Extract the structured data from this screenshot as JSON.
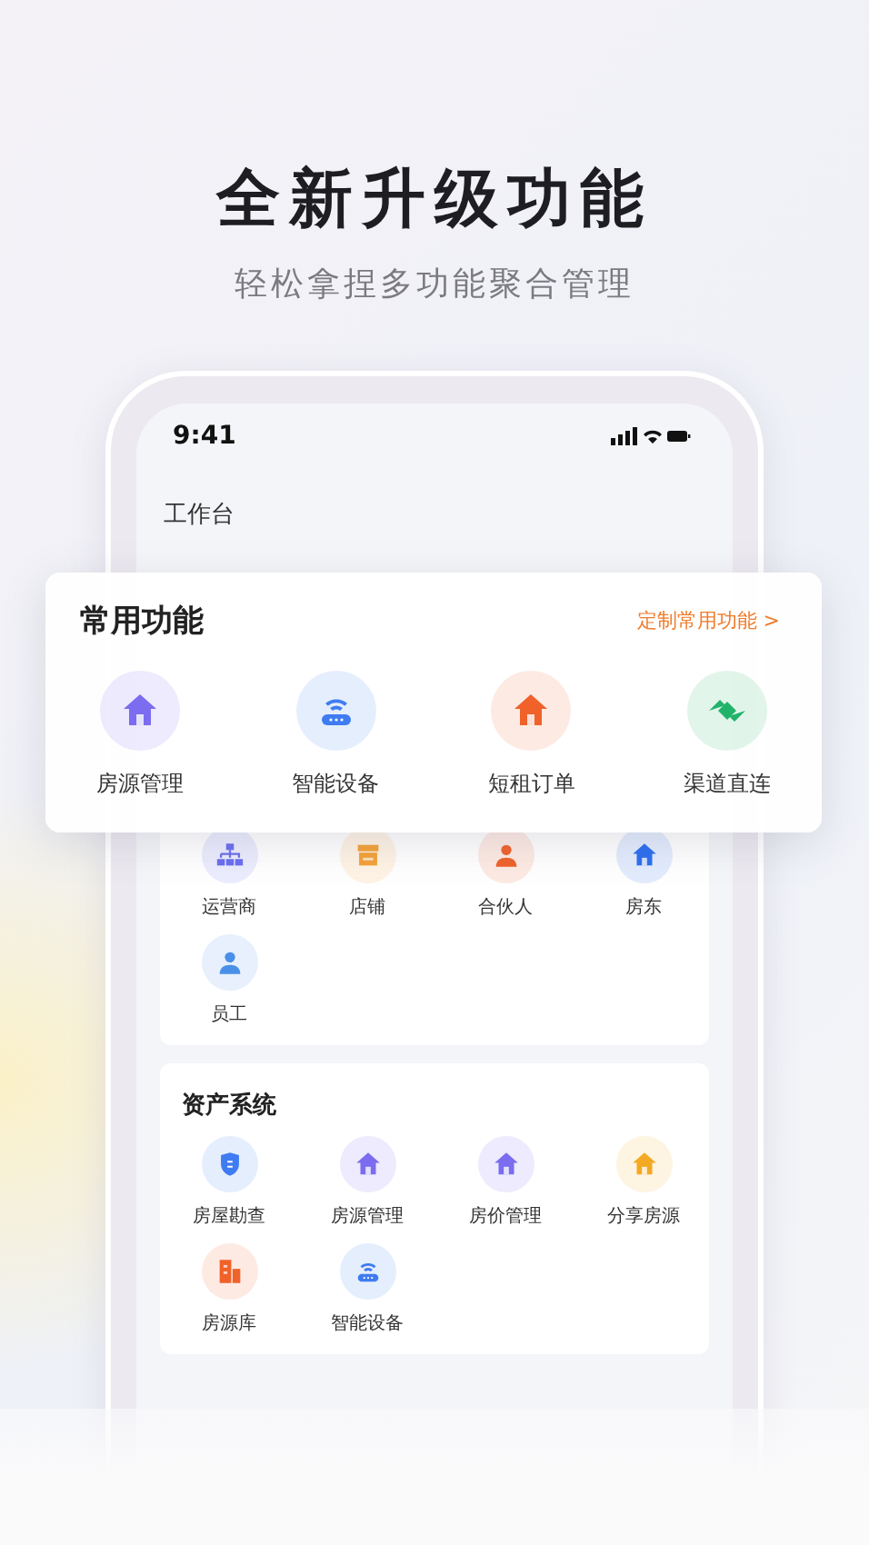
{
  "headline": "全新升级功能",
  "subheadline": "轻松拿捏多功能聚合管理",
  "status_bar": {
    "time": "9:41"
  },
  "page_title": "工作台",
  "featured": {
    "title": "常用功能",
    "link": "定制常用功能 >",
    "items": [
      {
        "label": "房源管理",
        "kind": "house",
        "color": "#7b6cf0"
      },
      {
        "label": "智能设备",
        "kind": "router",
        "color": "#3f7cf2"
      },
      {
        "label": "短租订单",
        "kind": "house",
        "color": "#f0622a"
      },
      {
        "label": "渠道直连",
        "kind": "link",
        "color": "#22b36b"
      }
    ]
  },
  "sections": [
    {
      "items": [
        {
          "label": "运营商",
          "kind": "org",
          "color": "#6b6ef0"
        },
        {
          "label": "店铺",
          "kind": "shop",
          "color": "#f4a237"
        },
        {
          "label": "合伙人",
          "kind": "person",
          "color": "#f0622a"
        },
        {
          "label": "房东",
          "kind": "house",
          "color": "#2c6ff0"
        },
        {
          "label": "员工",
          "kind": "person",
          "color": "#4a90e8"
        }
      ]
    },
    {
      "title": "资产系统",
      "items": [
        {
          "label": "房屋勘查",
          "kind": "shield",
          "color": "#3f7cf2"
        },
        {
          "label": "房源管理",
          "kind": "house",
          "color": "#7b6cf0"
        },
        {
          "label": "房价管理",
          "kind": "house",
          "color": "#7b6cf0"
        },
        {
          "label": "分享房源",
          "kind": "house",
          "color": "#f4a923"
        },
        {
          "label": "房源库",
          "kind": "building",
          "color": "#f0622a"
        },
        {
          "label": "智能设备",
          "kind": "router",
          "color": "#3f7cf2"
        }
      ]
    }
  ]
}
